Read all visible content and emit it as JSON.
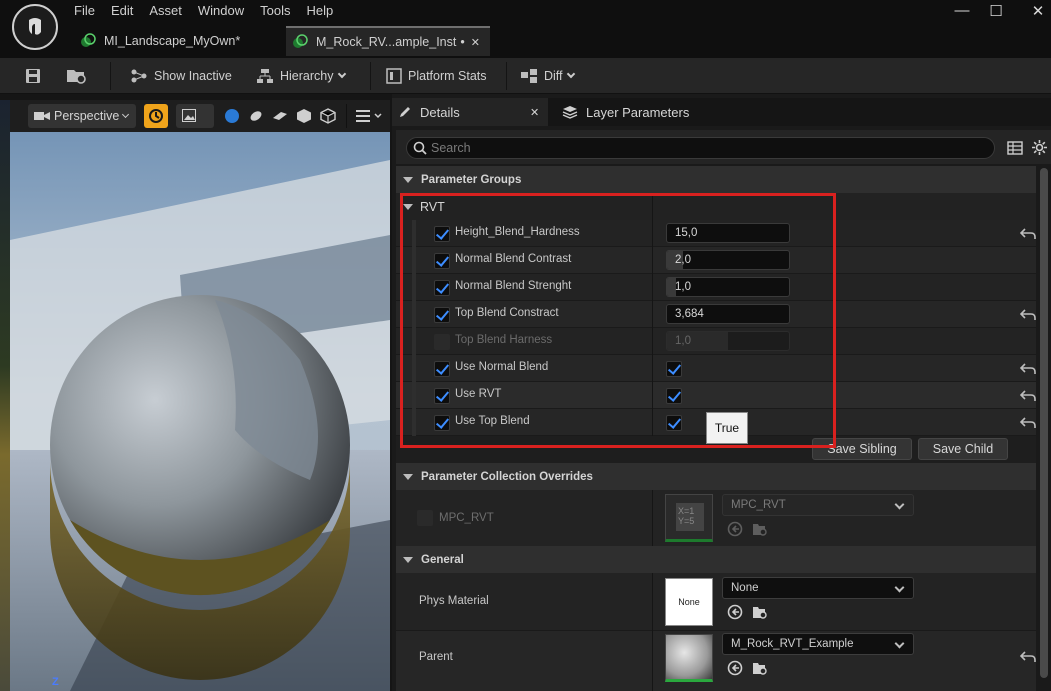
{
  "menu": [
    "File",
    "Edit",
    "Asset",
    "Window",
    "Tools",
    "Help"
  ],
  "window_controls": {
    "minimize": "—",
    "maximize": "☐",
    "close": "✕"
  },
  "doc_tabs": [
    {
      "label": "MI_Landscape_MyOwn*",
      "close": ""
    },
    {
      "label": "M_Rock_RV...ample_Inst",
      "modified": "•",
      "close": "✕"
    }
  ],
  "toolbar": {
    "show_inactive": "Show Inactive",
    "hierarchy": "Hierarchy",
    "platform_stats": "Platform Stats",
    "diff": "Diff"
  },
  "viewport": {
    "perspective_label": "Perspective",
    "axis_label": "Z"
  },
  "panel_tabs": {
    "details": "Details",
    "details_close": "✕",
    "layer_parameters": "Layer Parameters"
  },
  "search": {
    "placeholder": "Search",
    "value": ""
  },
  "parameter_groups": {
    "header": "Parameter Groups",
    "rvt_group": "RVT",
    "rows": [
      {
        "name": "Height_Blend_Hardness",
        "enabled": true,
        "value": "15,0",
        "fill": 0.0,
        "reset": true,
        "disabled": false
      },
      {
        "name": "Normal Blend Contrast",
        "enabled": true,
        "value": "2,0",
        "fill": 0.13,
        "reset": false,
        "disabled": false
      },
      {
        "name": "Normal Blend Strenght",
        "enabled": true,
        "value": "1,0",
        "fill": 0.07,
        "reset": false,
        "disabled": false
      },
      {
        "name": "Top Blend Constract",
        "enabled": true,
        "value": "3,684",
        "fill": 0.0,
        "reset": true,
        "disabled": false
      },
      {
        "name": "Top Blend Harness",
        "enabled": false,
        "value": "1,0",
        "fill": 0.5,
        "reset": false,
        "disabled": true
      }
    ],
    "bool_rows": [
      {
        "name": "Use Normal Blend",
        "enabled": true,
        "checked": true,
        "reset": true
      },
      {
        "name": "Use RVT",
        "enabled": true,
        "checked": true,
        "reset": true
      },
      {
        "name": "Use Top Blend",
        "enabled": true,
        "checked": true,
        "reset": true
      }
    ],
    "tooltip": "True",
    "save_sibling": "Save Sibling",
    "save_child": "Save Child"
  },
  "collection_overrides": {
    "header": "Parameter Collection Overrides",
    "name": "MPC_RVT",
    "value": "MPC_RVT",
    "thumb_text": "X=1\nY=5"
  },
  "general": {
    "header": "General",
    "phys_material_label": "Phys Material",
    "phys_material_value": "None",
    "phys_material_thumb": "None",
    "parent_label": "Parent",
    "parent_value": "M_Rock_RVT_Example"
  },
  "colors": {
    "accent_blue": "#3d8dff",
    "highlight_red": "#d9211f",
    "panel_bg": "#1a1a1a"
  }
}
